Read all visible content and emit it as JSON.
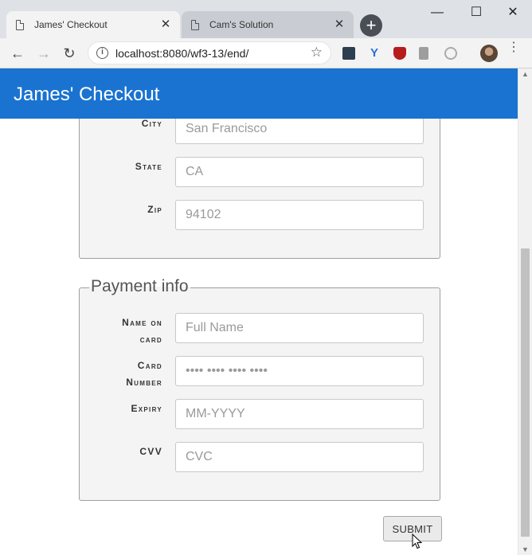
{
  "browser": {
    "tabs": [
      {
        "title": "James' Checkout",
        "close": "✕"
      },
      {
        "title": "Cam's Solution",
        "close": "✕"
      }
    ],
    "new_tab": "+",
    "window": {
      "minimize": "—",
      "maximize": "☐",
      "close": "✕"
    },
    "nav": {
      "back": "←",
      "forward": "→",
      "reload": "↻"
    },
    "url": "localhost:8080/wf3-13/end/",
    "info_icon": "i",
    "bookmark_icon": "☆",
    "menu_icon": "⋮",
    "extensions": [
      "ext-dark-square-icon",
      "ext-v-icon",
      "ublock-icon",
      "ext-bookmark-icon",
      "ext-circle-icon"
    ]
  },
  "app": {
    "title": "James' Checkout",
    "header_color": "#1a73d0"
  },
  "address": {
    "city": {
      "label": "City",
      "placeholder": "San Francisco"
    },
    "state": {
      "label": "State",
      "placeholder": "CA"
    },
    "zip": {
      "label": "Zip",
      "placeholder": "94102"
    }
  },
  "payment": {
    "legend": "Payment info",
    "name": {
      "label_line1": "Name on",
      "label_line2": "card",
      "placeholder": "Full Name"
    },
    "card_number": {
      "label_line1": "Card",
      "label_line2": "Number",
      "placeholder": "•••• •••• •••• ••••"
    },
    "expiry": {
      "label": "Expiry",
      "placeholder": "MM-YYYY"
    },
    "cvv": {
      "label": "CVV",
      "placeholder": "CVC"
    }
  },
  "submit_label": "SUBMIT"
}
